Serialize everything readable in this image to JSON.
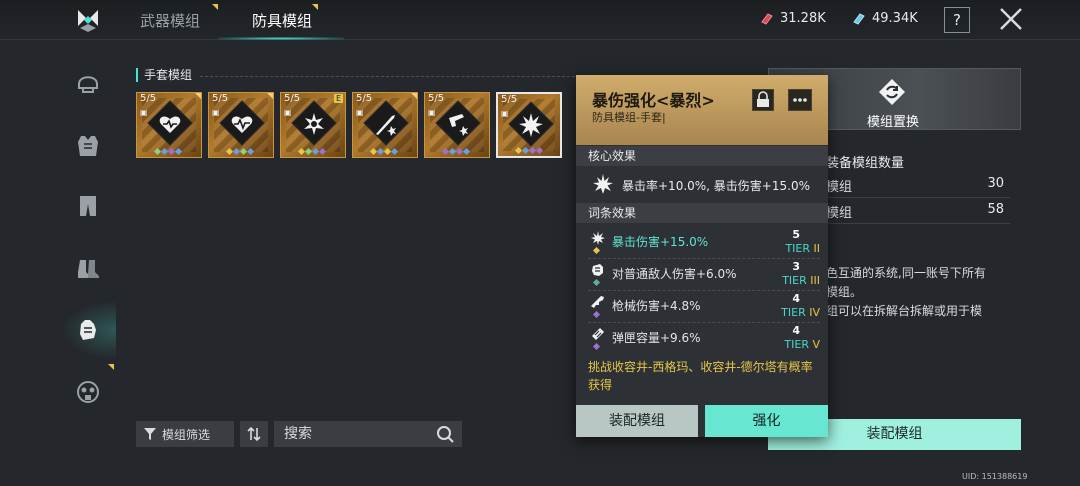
{
  "header": {
    "tabs": [
      {
        "label": "武器模组",
        "active": false
      },
      {
        "label": "防具模组",
        "active": true
      }
    ],
    "currencies": [
      {
        "icon": "red-crystal-icon",
        "value": "31.28K",
        "color": "#d84a5a"
      },
      {
        "icon": "blue-crystal-icon",
        "value": "49.34K",
        "color": "#6cc6e8"
      }
    ],
    "help_label": "?"
  },
  "leftnav": {
    "items": [
      {
        "icon": "helmet-icon"
      },
      {
        "icon": "armor-vest-icon"
      },
      {
        "icon": "leg-armor-icon"
      },
      {
        "icon": "boots-icon"
      },
      {
        "icon": "glove-icon",
        "active": true
      },
      {
        "icon": "gas-mask-icon"
      }
    ]
  },
  "section": {
    "title": "手套模组"
  },
  "modules": [
    {
      "count": "5/5",
      "icon": "heart-icon",
      "dots": [
        "#8ed27a",
        "#6aa0e0",
        "#a070d0",
        "#6aa0e0"
      ]
    },
    {
      "count": "5/5",
      "icon": "heartbeat-icon",
      "dots": [
        "#e6c54a",
        "#6aa0e0",
        "#8ed27a",
        "#6aa0e0"
      ]
    },
    {
      "count": "5/5",
      "icon": "target-burst-icon",
      "dots": [
        "#e6c54a",
        "#8ed27a",
        "#6aa0e0",
        "#a070d0"
      ],
      "badge": "E"
    },
    {
      "count": "5/5",
      "icon": "blade-shuriken-icon",
      "dots": [
        "#e6c54a",
        "#6aa0e0",
        "#e6c54a",
        "#6aa0e0"
      ]
    },
    {
      "count": "5/5",
      "icon": "gun-shuriken-icon",
      "dots": [
        "#a070d0",
        "#6aa0e0",
        "#a070d0",
        "#6aa0e0"
      ]
    },
    {
      "count": "5/5",
      "icon": "explosion-icon",
      "dots": [
        "#e6c54a",
        "#6aa0e0",
        "#a070d0",
        "#a070d0"
      ],
      "selected": true
    }
  ],
  "filter": {
    "filter_label": "模组筛选",
    "search_placeholder": "搜索"
  },
  "right_panel": {
    "swap_label": "模组置换",
    "stat_title": "装备模组数量",
    "stats": [
      {
        "label": "模组",
        "value": "30"
      },
      {
        "label": "模组",
        "value": "58"
      }
    ],
    "desc_lines": [
      "色互通的系统,同一账号下所有",
      "模组。",
      "组可以在拆解台拆解或用于模"
    ],
    "equip_label": "装配模组"
  },
  "popup": {
    "title": "暴伤强化<暴烈>",
    "subtitle": "防具模组-手套|",
    "core_header": "核心效果",
    "core_text": "暴击率+10.0%, 暴击伤害+15.0%",
    "affix_header": "词条效果",
    "affixes": [
      {
        "icon": "burst-icon",
        "text": "暴击伤害+15.0%",
        "num": "5",
        "tier_label": "TIER",
        "tier_roman": "II",
        "gem": "#e6c54a",
        "highlight": true
      },
      {
        "icon": "fist-icon",
        "text": "对普通敌人伤害+6.0%",
        "num": "3",
        "tier_label": "TIER",
        "tier_roman": "III",
        "gem": "#5ab0a0",
        "highlight": false
      },
      {
        "icon": "rifle-icon",
        "text": "枪械伤害+4.8%",
        "num": "4",
        "tier_label": "TIER",
        "tier_roman": "IV",
        "gem": "#a070d0",
        "highlight": false
      },
      {
        "icon": "magazine-icon",
        "text": "弹匣容量+9.6%",
        "num": "4",
        "tier_label": "TIER",
        "tier_roman": "V",
        "gem": "#a070d0",
        "highlight": false
      }
    ],
    "source_text": "挑战收容井-西格玛、收容井-德尔塔有概率获得",
    "equip_button": "装配模组",
    "upgrade_button": "强化"
  },
  "uid_text": "UID: 151388619"
}
